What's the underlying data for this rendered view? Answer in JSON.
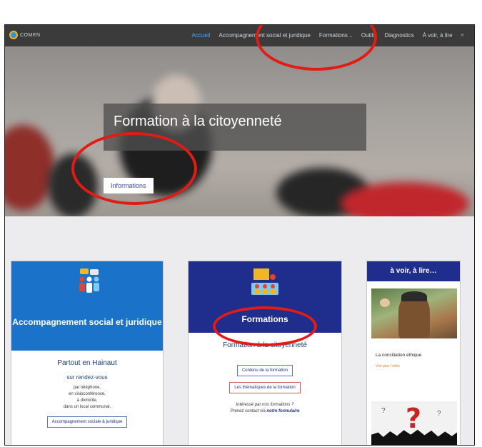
{
  "site": {
    "logo_text": "COMEN"
  },
  "nav": {
    "items": [
      "Accueil",
      "Accompagnement social et juridique",
      "Formations",
      "Outils",
      "Diagnostics",
      "À voir, à lire"
    ],
    "formations_chevron": "⌄",
    "search_icon": "⌕"
  },
  "hero": {
    "title": "Formation à la citoyenneté",
    "button": "Informations",
    "slides": 3
  },
  "card_social": {
    "title": "Accompagnement social et juridique",
    "subtitle": "Partout en Hainaut",
    "lead": "sur rendez-vous",
    "lines": [
      "par téléphone,",
      "en visioconférence,",
      "à domicile,",
      "dans un local communal."
    ],
    "button": "Accompagnement sociale & juridique"
  },
  "card_formations": {
    "title": "Formations",
    "subtitle": "Formation à la citoyenneté",
    "button1": "Contenu de la formation",
    "button2": "Les thématiques de la formation",
    "note_line1": "Intéressé par nos formations ?",
    "note_line2": "Prenez contact via ",
    "note_link": "notre formulaire"
  },
  "card_voir": {
    "title": "à voir, à lire…",
    "article_title": "La conciliation éthique",
    "article_link": "Voir plus / infos"
  },
  "colors": {
    "nav_bg": "#3b3b3b",
    "accent_active": "#4aa0ff",
    "card_blue": "#1a73c8",
    "card_navy": "#1f2d8c",
    "annotation_red": "#e21b14"
  }
}
